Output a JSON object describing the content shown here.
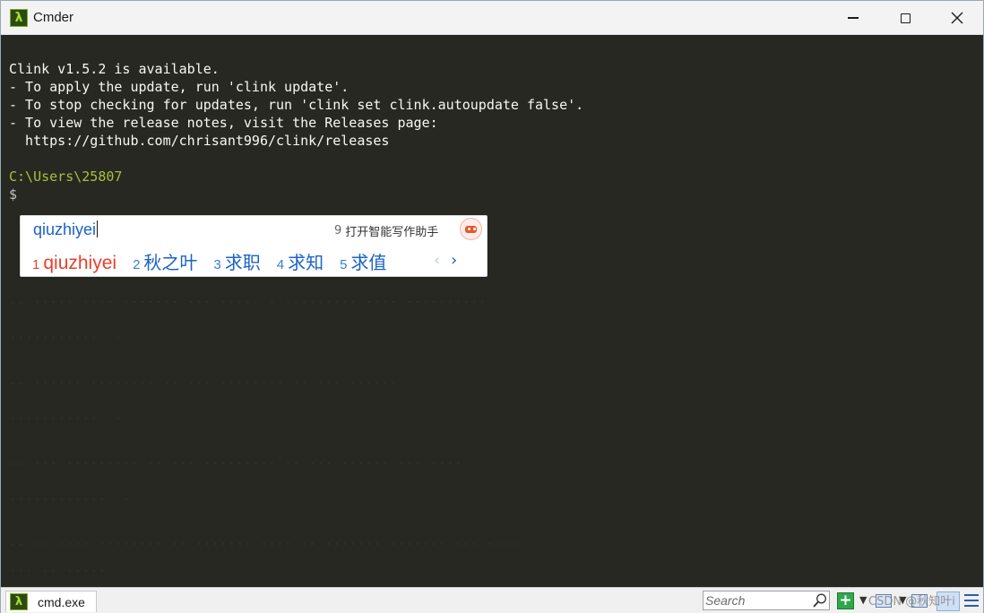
{
  "window": {
    "title": "Cmder",
    "app_icon_glyph": "λ",
    "controls": {
      "minimize": "minimize-icon",
      "maximize": "maximize-icon",
      "close": "close-icon"
    }
  },
  "terminal": {
    "update_notice": [
      "Clink v1.5.2 is available.",
      "- To apply the update, run 'clink update'.",
      "- To stop checking for updates, run 'clink set clink.autoupdate false'.",
      "- To view the release notes, visit the Releases page:",
      "  https://github.com/chrisant996/clink/releases"
    ],
    "cwd": "C:\\Users\\25807",
    "prompt_symbol": "$",
    "colors": {
      "background": "#272822",
      "text": "#f8f8f2",
      "path": "#a6c13a"
    }
  },
  "ime": {
    "composition": "qiuzhiyei",
    "assist_number": "9",
    "assist_label": "打开智能写作助手",
    "candidates": [
      {
        "num": "1",
        "text": "qiuzhiyei"
      },
      {
        "num": "2",
        "text": "秋之叶"
      },
      {
        "num": "3",
        "text": "求职"
      },
      {
        "num": "4",
        "text": "求知"
      },
      {
        "num": "5",
        "text": "求值"
      }
    ],
    "prev_glyph": "‹",
    "next_glyph": "›",
    "colors": {
      "highlight": "#e8402a",
      "candidate": "#1b62c8"
    }
  },
  "statusbar": {
    "tab_label": "cmd.exe",
    "search_placeholder": "Search",
    "watermark": "CSDN @秋知叶i"
  }
}
